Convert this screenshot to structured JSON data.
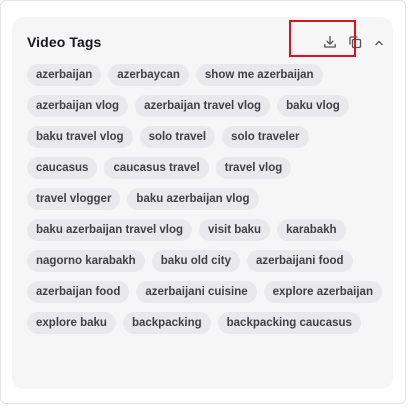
{
  "section": {
    "title": "Video Tags"
  },
  "icons": {
    "download": "download-icon",
    "copy": "copy-icon",
    "collapse": "chevron-up-icon"
  },
  "colors": {
    "highlight_border": "#e3101a",
    "tag_background": "#e9e9eb",
    "tag_text": "#3f3f46",
    "panel_background": "#f6f6f7"
  },
  "tags": [
    "azerbaijan",
    "azerbaycan",
    "show me azerbaijan",
    "azerbaijan vlog",
    "azerbaijan travel vlog",
    "baku vlog",
    "baku travel vlog",
    "solo travel",
    "solo traveler",
    "caucasus",
    "caucasus travel",
    "travel vlog",
    "travel vlogger",
    "baku azerbaijan vlog",
    "baku azerbaijan travel vlog",
    "visit baku",
    "karabakh",
    "nagorno karabakh",
    "baku old city",
    "azerbaijani food",
    "azerbaijan food",
    "azerbaijani cuisine",
    "explore azerbaijan",
    "explore baku",
    "backpacking",
    "backpacking caucasus"
  ]
}
